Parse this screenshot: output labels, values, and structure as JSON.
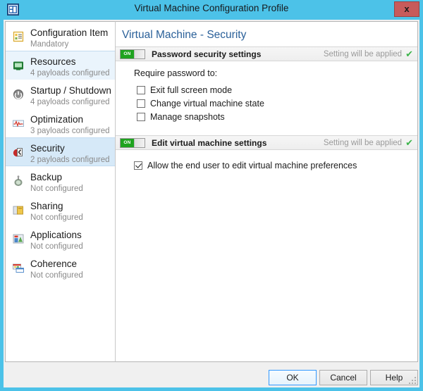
{
  "window": {
    "title": "Virtual Machine Configuration Profile",
    "icon": "profile-window-icon",
    "close_label": "x",
    "accent_color": "#4cc2e8"
  },
  "sidebar": {
    "items": [
      {
        "label": "Configuration Item",
        "sub": "Mandatory",
        "icon": "configuration-item-icon",
        "state": "normal"
      },
      {
        "label": "Resources",
        "sub": "4 payloads configured",
        "icon": "resources-monitor-icon",
        "state": "hover"
      },
      {
        "label": "Startup / Shutdown",
        "sub": "4 payloads configured",
        "icon": "power-icon",
        "state": "normal"
      },
      {
        "label": "Optimization",
        "sub": "3 payloads configured",
        "icon": "optimization-pulse-icon",
        "state": "normal"
      },
      {
        "label": "Security",
        "sub": "2 payloads configured",
        "icon": "security-shield-icon",
        "state": "selected"
      },
      {
        "label": "Backup",
        "sub": "Not configured",
        "icon": "backup-icon",
        "state": "normal"
      },
      {
        "label": "Sharing",
        "sub": "Not configured",
        "icon": "sharing-folder-icon",
        "state": "normal"
      },
      {
        "label": "Applications",
        "sub": "Not configured",
        "icon": "applications-icon",
        "state": "normal"
      },
      {
        "label": "Coherence",
        "sub": "Not configured",
        "icon": "coherence-window-icon",
        "state": "normal"
      }
    ]
  },
  "main": {
    "title": "Virtual Machine - Security",
    "sections": [
      {
        "toggle_label": "ON",
        "toggle_on": true,
        "label": "Password security settings",
        "status": "Setting will be applied",
        "status_icon": "green-check-icon",
        "prompt": "Require password to:",
        "checkboxes": [
          {
            "label": "Exit full screen mode",
            "checked": false
          },
          {
            "label": "Change virtual machine state",
            "checked": false
          },
          {
            "label": "Manage snapshots",
            "checked": false
          }
        ]
      },
      {
        "toggle_label": "ON",
        "toggle_on": true,
        "label": "Edit virtual machine settings",
        "status": "Setting will be applied",
        "status_icon": "green-check-icon",
        "prompt": "",
        "checkboxes": [
          {
            "label": "Allow the end user to edit virtual machine preferences",
            "checked": true
          }
        ]
      }
    ]
  },
  "footer": {
    "ok_label": "OK",
    "cancel_label": "Cancel",
    "help_label": "Help"
  }
}
